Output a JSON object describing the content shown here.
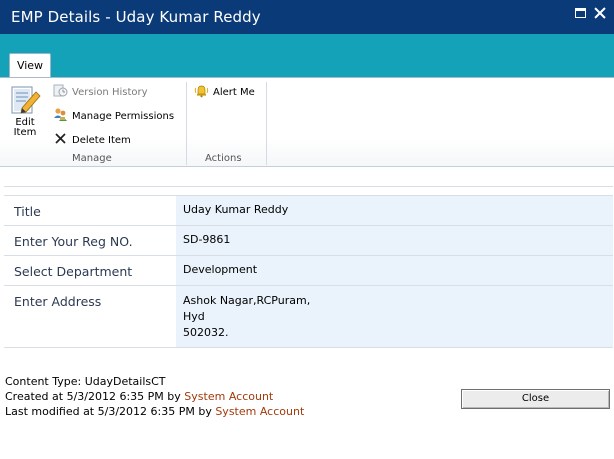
{
  "window": {
    "title": "EMP Details - Uday Kumar Reddy"
  },
  "ribbon": {
    "tab_label": "View",
    "manage": {
      "group_label": "Manage",
      "edit_item": "Edit Item",
      "version_history": "Version History",
      "manage_permissions": "Manage Permissions",
      "delete_item": "Delete Item"
    },
    "actions": {
      "group_label": "Actions",
      "alert_me": "Alert Me"
    }
  },
  "form": {
    "rows": [
      {
        "label": "Title",
        "value": "Uday Kumar Reddy"
      },
      {
        "label": "Enter Your Reg NO.",
        "value": "SD-9861"
      },
      {
        "label": "Select Department",
        "value": "Development"
      },
      {
        "label": "Enter Address",
        "lines": [
          "Ashok Nagar,RCPuram,",
          "Hyd",
          "502032."
        ]
      }
    ]
  },
  "footer": {
    "content_type": "Content Type: UdayDetailsCT",
    "created_prefix": "Created at 5/3/2012 6:35 PM by ",
    "created_by": "System Account",
    "modified_prefix": "Last modified at 5/3/2012 6:35 PM by ",
    "modified_by": "System Account",
    "close_label": "Close"
  },
  "icons": {
    "edit_item": "edit-item-icon",
    "version_history": "version-history-icon",
    "manage_permissions": "manage-permissions-icon",
    "delete_item": "delete-x-icon",
    "alert_me": "alert-bell-icon",
    "maximize": "maximize-icon",
    "close": "close-icon"
  },
  "colors": {
    "titlebar": "#0a3a78",
    "band": "#14a2b8",
    "value_cell": "#eaf3fb",
    "account_link": "#a13a0b"
  }
}
